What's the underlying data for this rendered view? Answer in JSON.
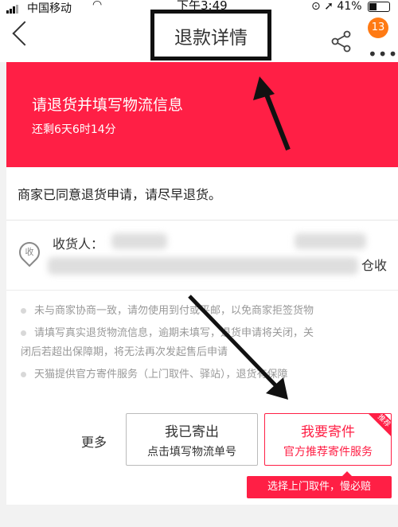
{
  "status_bar": {
    "carrier": "中国移动",
    "time": "下午3:49",
    "battery": "41%"
  },
  "nav": {
    "title": "退款详情",
    "badge_count": "13"
  },
  "banner": {
    "title": "请退货并填写物流信息",
    "countdown": "还剩6天6时14分"
  },
  "status_message": "商家已同意退货申请，请尽早退货。",
  "address": {
    "receiver_label": "收货人：",
    "address_tail": "仓收"
  },
  "notes": [
    "未与商家协商一致，请勿使用到付或平邮，以免商家拒签货物",
    "请填写真实退货物流信息，逾期未填写，退货申请将关闭，关",
    "闭后若超出保障期，将无法再次发起售后申请",
    "天猫提供官方寄件服务（上门取件、驿站），退货有保障"
  ],
  "actions": {
    "more_label": "更多",
    "sent_button": {
      "line1": "我已寄出",
      "line2": "点击填写物流单号"
    },
    "ship_button": {
      "line1": "我要寄件",
      "line2": "官方推荐寄件服务",
      "tag": "推荐"
    },
    "tooltip": "选择上门取件，慢必赔"
  },
  "colors": {
    "accent": "#ff1f45",
    "badge": "#ff7a14"
  },
  "icons": [
    "back-icon",
    "share-icon",
    "more-icon",
    "location-icon",
    "wifi-icon",
    "battery-icon"
  ]
}
